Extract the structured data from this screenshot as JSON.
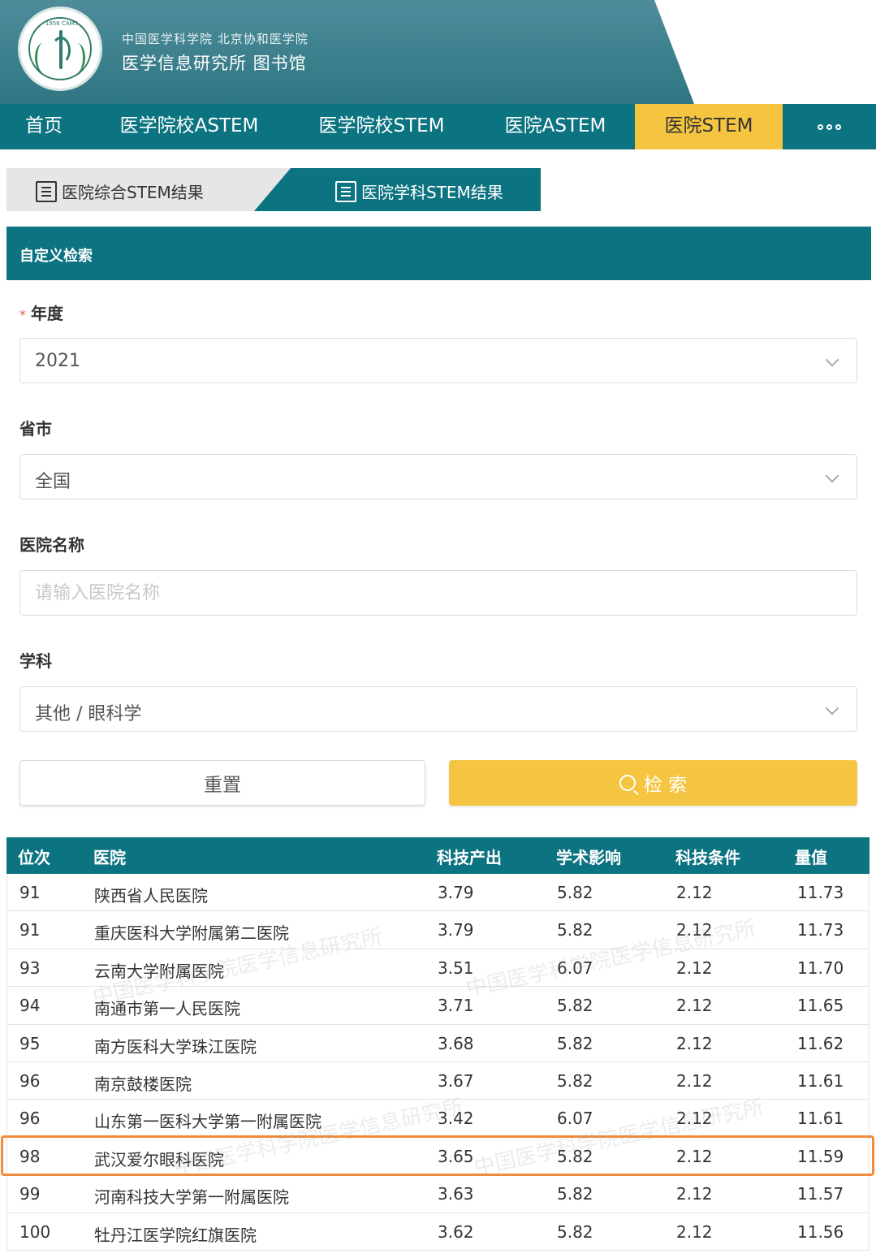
{
  "header": {
    "org_line1": "中国医学科学院 北京协和医学院",
    "org_line2": "医学信息研究所 图书馆",
    "logo_text": "1956 CAMS"
  },
  "nav": {
    "items": [
      "首页",
      "医学院校ASTEM",
      "医学院校STEM",
      "医院ASTEM",
      "医院STEM"
    ],
    "active": "医院STEM",
    "more_icon": "more-dots-icon"
  },
  "subtabs": {
    "tab1": "医院综合STEM结果",
    "tab2": "医院学科STEM结果",
    "active": "医院学科STEM结果"
  },
  "search": {
    "title": "自定义检索",
    "year_label": "年度",
    "year_required_mark": "*",
    "year_value": "2021",
    "province_label": "省市",
    "province_value": "全国",
    "hospital_label": "医院名称",
    "hospital_placeholder": "请输入医院名称",
    "subject_label": "学科",
    "subject_value": "其他 / 眼科学",
    "reset_label": "重置",
    "search_label": "检 索"
  },
  "table": {
    "headers": [
      "位次",
      "医院",
      "科技产出",
      "学术影响",
      "科技条件",
      "量值"
    ],
    "rows": [
      [
        "91",
        "陕西省人民医院",
        "3.79",
        "5.82",
        "2.12",
        "11.73"
      ],
      [
        "91",
        "重庆医科大学附属第二医院",
        "3.79",
        "5.82",
        "2.12",
        "11.73"
      ],
      [
        "93",
        "云南大学附属医院",
        "3.51",
        "6.07",
        "2.12",
        "11.70"
      ],
      [
        "94",
        "南通市第一人民医院",
        "3.71",
        "5.82",
        "2.12",
        "11.65"
      ],
      [
        "95",
        "南方医科大学珠江医院",
        "3.68",
        "5.82",
        "2.12",
        "11.62"
      ],
      [
        "96",
        "南京鼓楼医院",
        "3.67",
        "5.82",
        "2.12",
        "11.61"
      ],
      [
        "96",
        "山东第一医科大学第一附属医院",
        "3.42",
        "6.07",
        "2.12",
        "11.61"
      ],
      [
        "98",
        "武汉爱尔眼科医院",
        "3.65",
        "5.82",
        "2.12",
        "11.59"
      ],
      [
        "99",
        "河南科技大学第一附属医院",
        "3.63",
        "5.82",
        "2.12",
        "11.57"
      ],
      [
        "100",
        "牡丹江医学院红旗医院",
        "3.62",
        "5.82",
        "2.12",
        "11.56"
      ]
    ],
    "highlighted_row": 7
  },
  "watermark": "中国医学科学院医学信息研究所",
  "colors": {
    "primary": "#0c7381",
    "accent": "#f5c441",
    "highlight_border": "#ef8b3b"
  }
}
